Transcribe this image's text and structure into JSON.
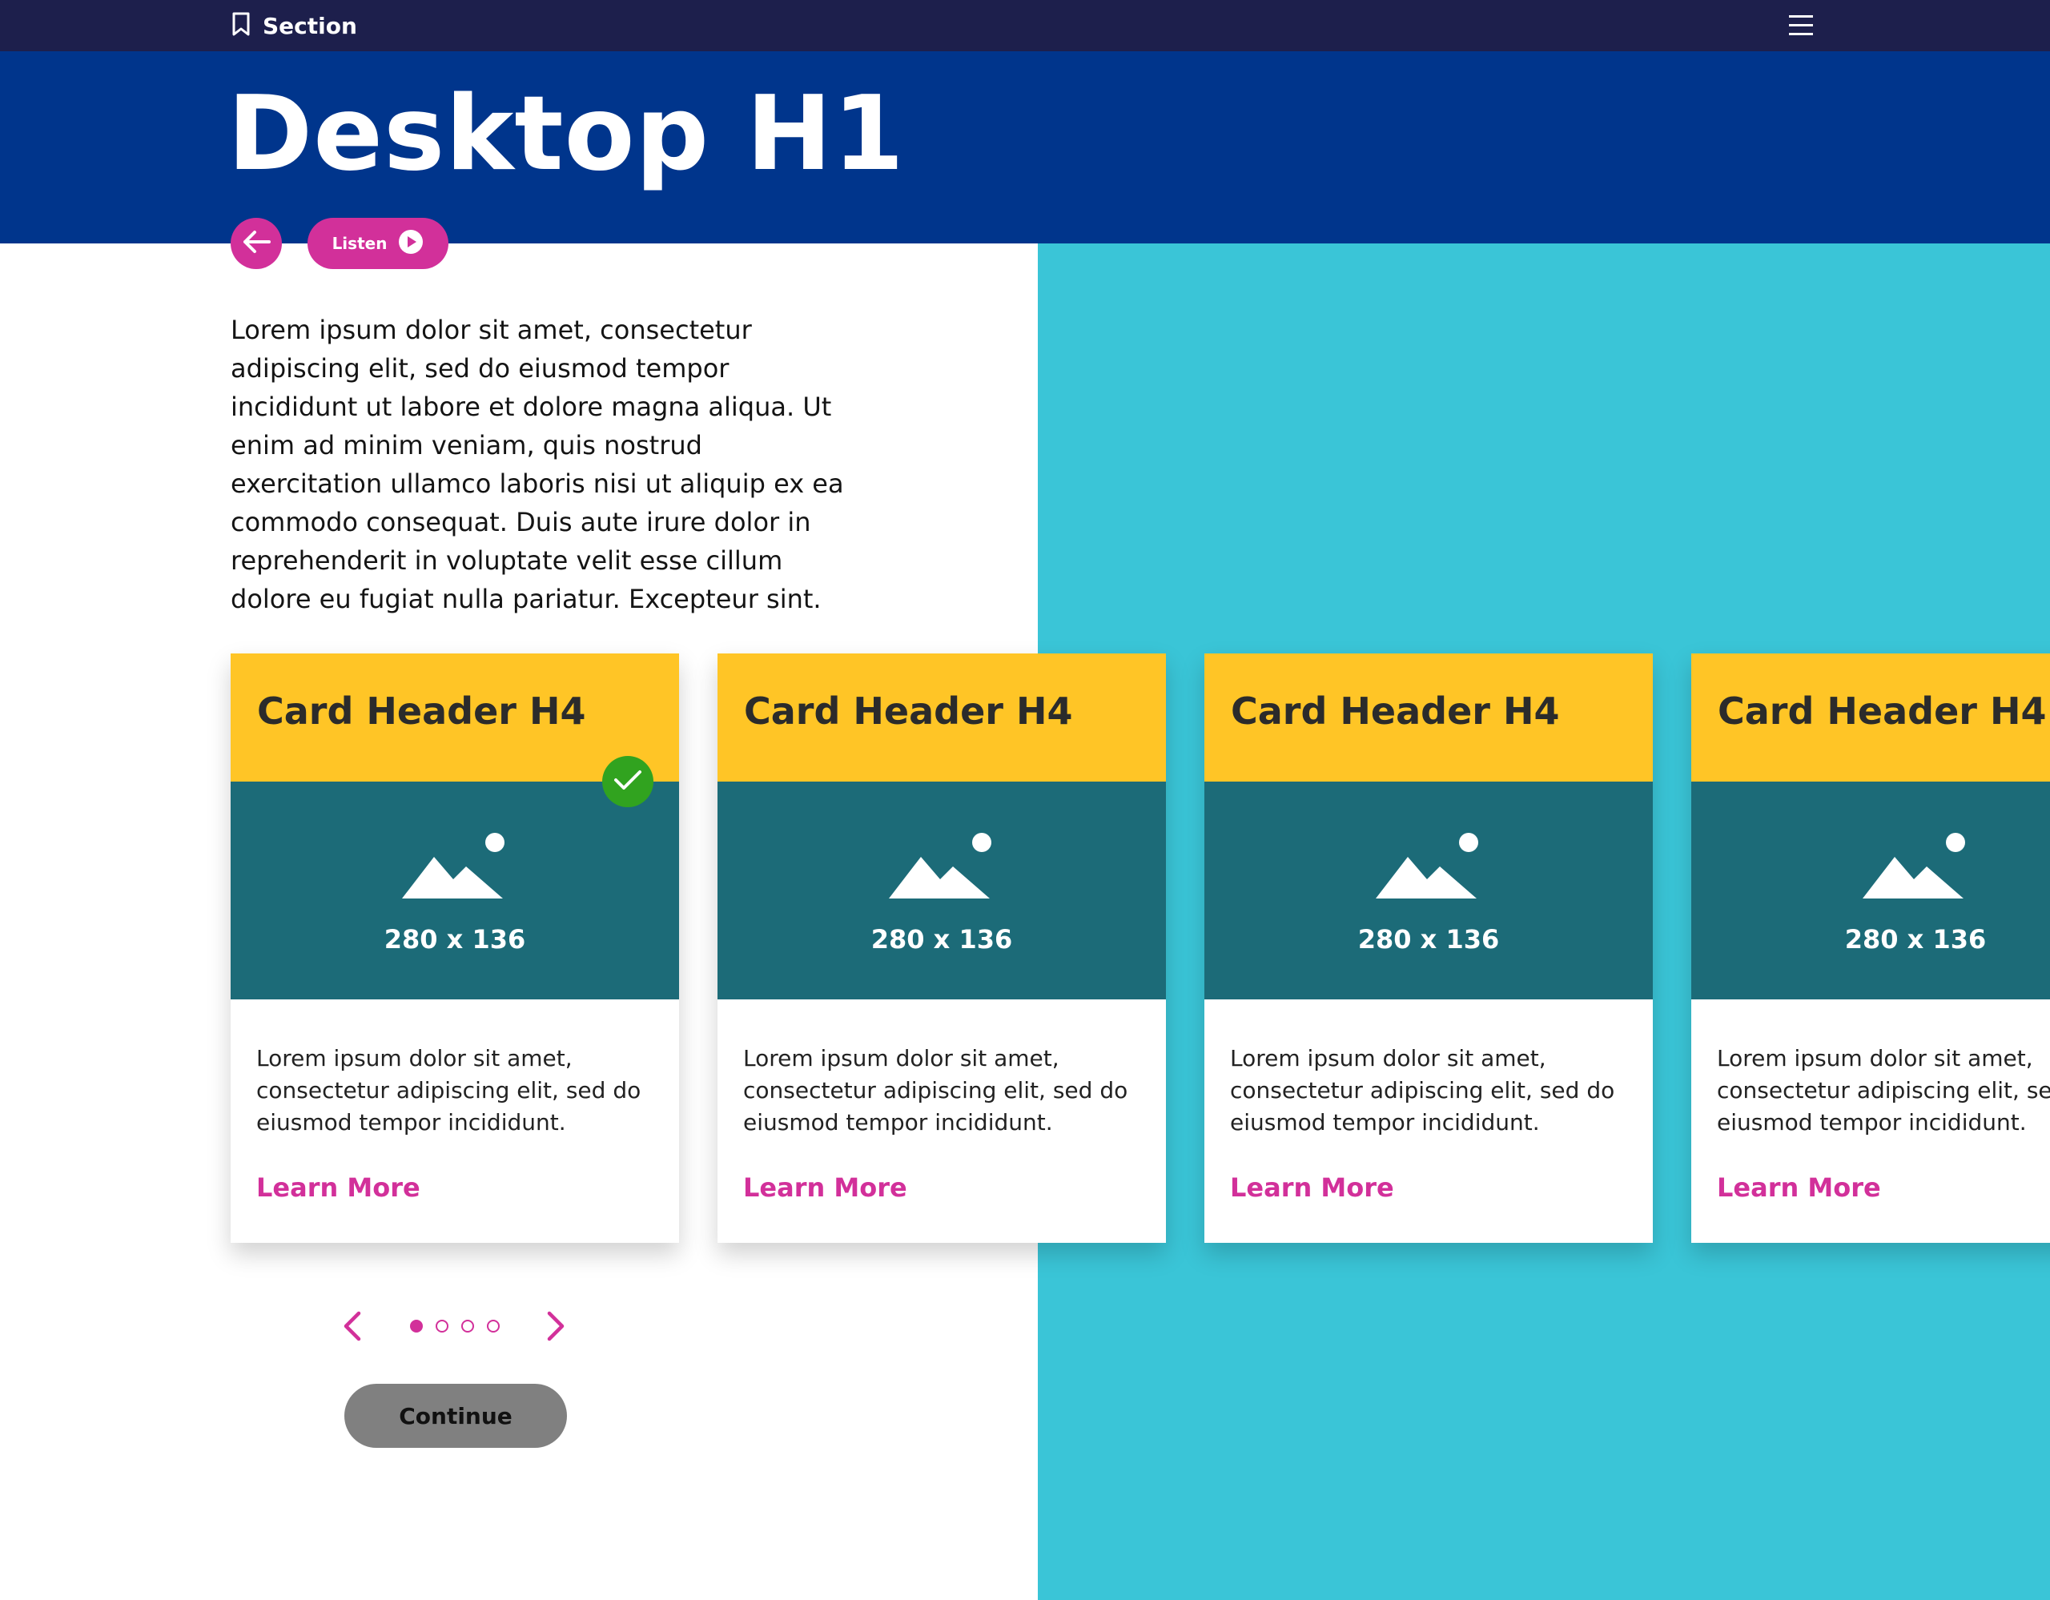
{
  "topbar": {
    "section_label": "Section",
    "bookmark_icon": "bookmark-icon",
    "menu_icon": "hamburger-menu-icon"
  },
  "hero": {
    "title": "Desktop H1"
  },
  "actions": {
    "back_icon": "arrow-left-icon",
    "listen_label": "Listen",
    "listen_icon": "play-circle-icon"
  },
  "intro": {
    "text": "Lorem ipsum dolor sit amet, consectetur adipiscing elit, sed do eiusmod tempor incididunt ut labore et dolore magna aliqua. Ut enim ad minim veniam, quis nostrud exercitation ullamco laboris nisi ut aliquip ex ea commodo consequat. Duis aute irure dolor in reprehenderit in voluptate velit esse cillum dolore eu fugiat nulla pariatur. Excepteur sint."
  },
  "cards": [
    {
      "title": "Card Header H4",
      "image_caption": "280 x 136",
      "body": "Lorem ipsum dolor sit amet,\nconsectetur adipiscing elit, sed do\neiusmod tempor incididunt.",
      "link": "Learn More",
      "selected": true
    },
    {
      "title": "Card Header H4",
      "image_caption": "280 x 136",
      "body": "Lorem ipsum dolor sit amet,\nconsectetur adipiscing elit, sed do\neiusmod tempor incididunt.",
      "link": "Learn More",
      "selected": false
    },
    {
      "title": "Card Header H4",
      "image_caption": "280 x 136",
      "body": "Lorem ipsum dolor sit amet,\nconsectetur adipiscing elit, sed do\neiusmod tempor incididunt.",
      "link": "Learn More",
      "selected": false
    },
    {
      "title": "Card Header H4",
      "image_caption": "280 x 136",
      "body": "Lorem ipsum dolor sit amet,\nconsectetur adipiscing elit, sed do\neiusmod tempor incididunt.",
      "link": "Learn More",
      "selected": false
    }
  ],
  "pagination": {
    "total": 4,
    "current": 1,
    "prev_icon": "chevron-left-icon",
    "next_icon": "chevron-right-icon"
  },
  "continue": {
    "label": "Continue"
  },
  "colors": {
    "topbar": "#1d1f4c",
    "hero": "#00358c",
    "accent": "#d2309a",
    "panel": "#3ac5d7",
    "card_header": "#ffc526",
    "card_media": "#1c6b78",
    "check": "#31a31f",
    "continue_button": "#808080"
  }
}
